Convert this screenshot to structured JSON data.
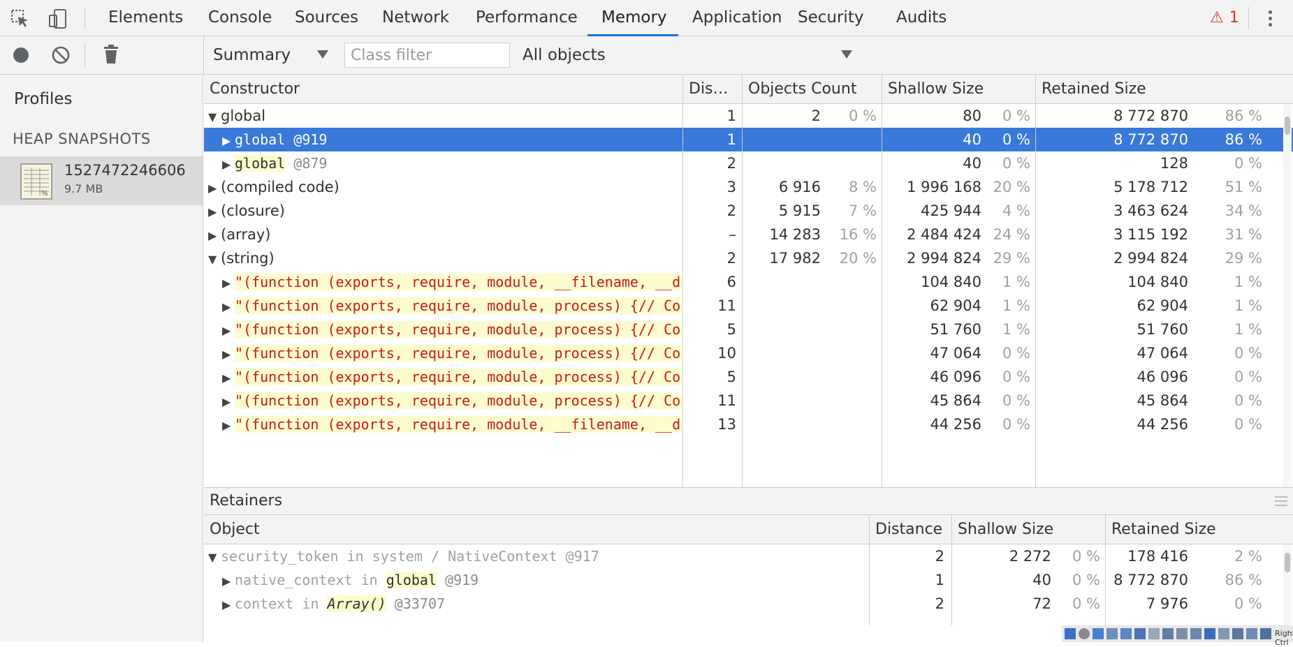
{
  "tabs": [
    {
      "label": "Elements"
    },
    {
      "label": "Console"
    },
    {
      "label": "Sources"
    },
    {
      "label": "Network"
    },
    {
      "label": "Performance"
    },
    {
      "label": "Memory"
    },
    {
      "label": "Application"
    },
    {
      "label": "Security"
    },
    {
      "label": "Audits"
    }
  ],
  "active_tab": "Memory",
  "warnings": {
    "icon": "warning-triangle-icon",
    "count": "1"
  },
  "toolbar": {
    "view": "Summary",
    "class_filter_placeholder": "Class filter",
    "objects_filter": "All objects"
  },
  "sidebar": {
    "title": "Profiles",
    "section": "HEAP SNAPSHOTS",
    "snapshot": {
      "name": "1527472246606",
      "size": "9.7 MB"
    }
  },
  "summary": {
    "headers": [
      "Constructor",
      "Dis…",
      "Objects Count",
      "Shallow Size",
      "Retained Size"
    ],
    "rows": [
      {
        "tri": "▼",
        "parts": [
          {
            "text": "global"
          }
        ],
        "dist": "1",
        "count": "2",
        "count_pct": "0 %",
        "shallow": "80",
        "shallow_pct": "0 %",
        "retained": "8 772 870",
        "retained_pct": "86 %"
      },
      {
        "tri": "▶",
        "parts": [
          {
            "text": "global",
            "mono": true
          },
          {
            "text": " @919",
            "at": true
          }
        ],
        "dist": "1",
        "count": "",
        "count_pct": "",
        "shallow": "40",
        "shallow_pct": "0 %",
        "retained": "8 772 870",
        "retained_pct": "86 %"
      },
      {
        "tri": "▶",
        "parts": [
          {
            "text": "global",
            "mono": true,
            "hl": true
          },
          {
            "text": " @879",
            "at": true
          }
        ],
        "dist": "2",
        "count": "",
        "count_pct": "",
        "shallow": "40",
        "shallow_pct": "0 %",
        "retained": "128",
        "retained_pct": "0 %"
      },
      {
        "tri": "▶",
        "parts": [
          {
            "text": "(compiled code)"
          }
        ],
        "dist": "3",
        "count": "6 916",
        "count_pct": "8 %",
        "shallow": "1 996 168",
        "shallow_pct": "20 %",
        "retained": "5 178 712",
        "retained_pct": "51 %"
      },
      {
        "tri": "▶",
        "parts": [
          {
            "text": "(closure)"
          }
        ],
        "dist": "2",
        "count": "5 915",
        "count_pct": "7 %",
        "shallow": "425 944",
        "shallow_pct": "4 %",
        "retained": "3 463 624",
        "retained_pct": "34 %"
      },
      {
        "tri": "▶",
        "parts": [
          {
            "text": "(array)"
          }
        ],
        "dist": "–",
        "count": "14 283",
        "count_pct": "16 %",
        "shallow": "2 484 424",
        "shallow_pct": "24 %",
        "retained": "3 115 192",
        "retained_pct": "31 %"
      },
      {
        "tri": "▼",
        "parts": [
          {
            "text": "(string)"
          }
        ],
        "dist": "2",
        "count": "17 982",
        "count_pct": "20 %",
        "shallow": "2 994 824",
        "shallow_pct": "29 %",
        "retained": "2 994 824",
        "retained_pct": "29 %"
      },
      {
        "tri": "▶",
        "parts": [
          {
            "text": "\"(function (exports, require, module, __filename, __dirname) {",
            "mono": true,
            "str": true
          }
        ],
        "dist": "6",
        "count": "",
        "count_pct": "",
        "shallow": "104 840",
        "shallow_pct": "1 %",
        "retained": "104 840",
        "retained_pct": "1 %"
      },
      {
        "tri": "▶",
        "parts": [
          {
            "text": "\"(function (exports, require, module, process) {// Copyright",
            "mono": true,
            "str": true
          }
        ],
        "dist": "11",
        "count": "",
        "count_pct": "",
        "shallow": "62 904",
        "shallow_pct": "1 %",
        "retained": "62 904",
        "retained_pct": "1 %"
      },
      {
        "tri": "▶",
        "parts": [
          {
            "text": "\"(function (exports, require, module, process) {// Copyright",
            "mono": true,
            "str": true
          }
        ],
        "dist": "5",
        "count": "",
        "count_pct": "",
        "shallow": "51 760",
        "shallow_pct": "1 %",
        "retained": "51 760",
        "retained_pct": "1 %"
      },
      {
        "tri": "▶",
        "parts": [
          {
            "text": "\"(function (exports, require, module, process) {// Copyright",
            "mono": true,
            "str": true
          }
        ],
        "dist": "10",
        "count": "",
        "count_pct": "",
        "shallow": "47 064",
        "shallow_pct": "0 %",
        "retained": "47 064",
        "retained_pct": "0 %"
      },
      {
        "tri": "▶",
        "parts": [
          {
            "text": "\"(function (exports, require, module, process) {// Copyright",
            "mono": true,
            "str": true
          }
        ],
        "dist": "5",
        "count": "",
        "count_pct": "",
        "shallow": "46 096",
        "shallow_pct": "0 %",
        "retained": "46 096",
        "retained_pct": "0 %"
      },
      {
        "tri": "▶",
        "parts": [
          {
            "text": "\"(function (exports, require, module, process) {// Copyright",
            "mono": true,
            "str": true
          }
        ],
        "dist": "11",
        "count": "",
        "count_pct": "",
        "shallow": "45 864",
        "shallow_pct": "0 %",
        "retained": "45 864",
        "retained_pct": "0 %"
      },
      {
        "tri": "▶",
        "parts": [
          {
            "text": "\"(function (exports, require, module, __filename, __dirname) {",
            "mono": true,
            "str": true
          }
        ],
        "dist": "13",
        "count": "",
        "count_pct": "",
        "shallow": "44 256",
        "shallow_pct": "0 %",
        "retained": "44 256",
        "retained_pct": "0 %"
      }
    ]
  },
  "retainers": {
    "title": "Retainers",
    "headers": [
      "Object",
      "Distance",
      "Shallow Size",
      "Retained Size"
    ],
    "rows": [
      {
        "tri": "▼",
        "parts": [
          {
            "text": "security_token in system / NativeContext @917",
            "mono": true,
            "muted": true
          }
        ],
        "dist": "2",
        "shallow": "2 272",
        "shallow_pct": "0 %",
        "retained": "178 416",
        "retained_pct": "2 %"
      },
      {
        "tri": "▶",
        "parts": [
          {
            "text": "native_context in ",
            "mono": true,
            "muted": true
          },
          {
            "text": "global",
            "mono": true,
            "hl": true
          },
          {
            "text": " @919",
            "at": true
          }
        ],
        "dist": "1",
        "shallow": "40",
        "shallow_pct": "0 %",
        "retained": "8 772 870",
        "retained_pct": "86 %"
      },
      {
        "tri": "▶",
        "parts": [
          {
            "text": "context in ",
            "mono": true,
            "muted": true
          },
          {
            "text": "Array()",
            "mono": true,
            "hl": true,
            "italic": true
          },
          {
            "text": " @33707",
            "at": true
          }
        ],
        "dist": "2",
        "shallow": "72",
        "shallow_pct": "0 %",
        "retained": "7 976",
        "retained_pct": "0 %"
      }
    ]
  },
  "taskbar": {
    "text": "Right Ctrl"
  },
  "colors": {
    "selection": "#3879d9",
    "active_tab_underline": "#1a73e8",
    "string_value": "#c41a16",
    "highlight": "#fdfccf"
  }
}
